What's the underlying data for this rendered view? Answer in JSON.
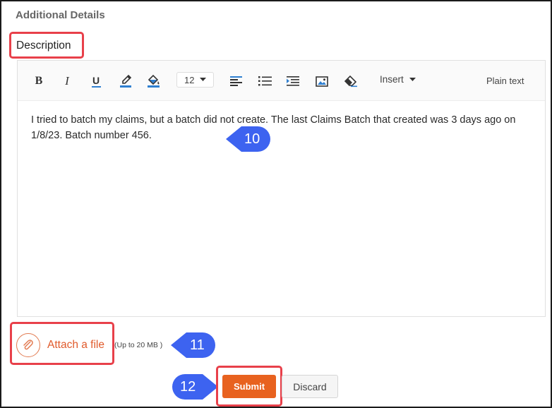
{
  "section": {
    "title": "Additional Details"
  },
  "description": {
    "label": "Description",
    "toolbar": {
      "bold": "B",
      "italic": "I",
      "underline": "U",
      "font_size": "12",
      "insert_label": "Insert",
      "plain_text_label": "Plain text",
      "icons": [
        "bold-icon",
        "italic-icon",
        "underline-icon",
        "text-color-icon",
        "fill-color-icon",
        "chevron-down-icon",
        "align-left-icon",
        "bullet-list-icon",
        "indent-icon",
        "image-icon",
        "eraser-icon"
      ]
    },
    "body_text": "I tried to batch my claims, but a batch did not create. The last Claims Batch that created was 3 days ago on 1/8/23. Batch number 456."
  },
  "attachment": {
    "label": "Attach a file",
    "hint": "(Up to 20 MB )"
  },
  "actions": {
    "submit_label": "Submit",
    "discard_label": "Discard"
  },
  "step_markers": [
    "10",
    "11",
    "12"
  ],
  "colors": {
    "callout_red": "#e8404a",
    "marker_blue": "#3d63f0",
    "accent_orange": "#e8621f",
    "link_orange": "#e05a2b"
  }
}
